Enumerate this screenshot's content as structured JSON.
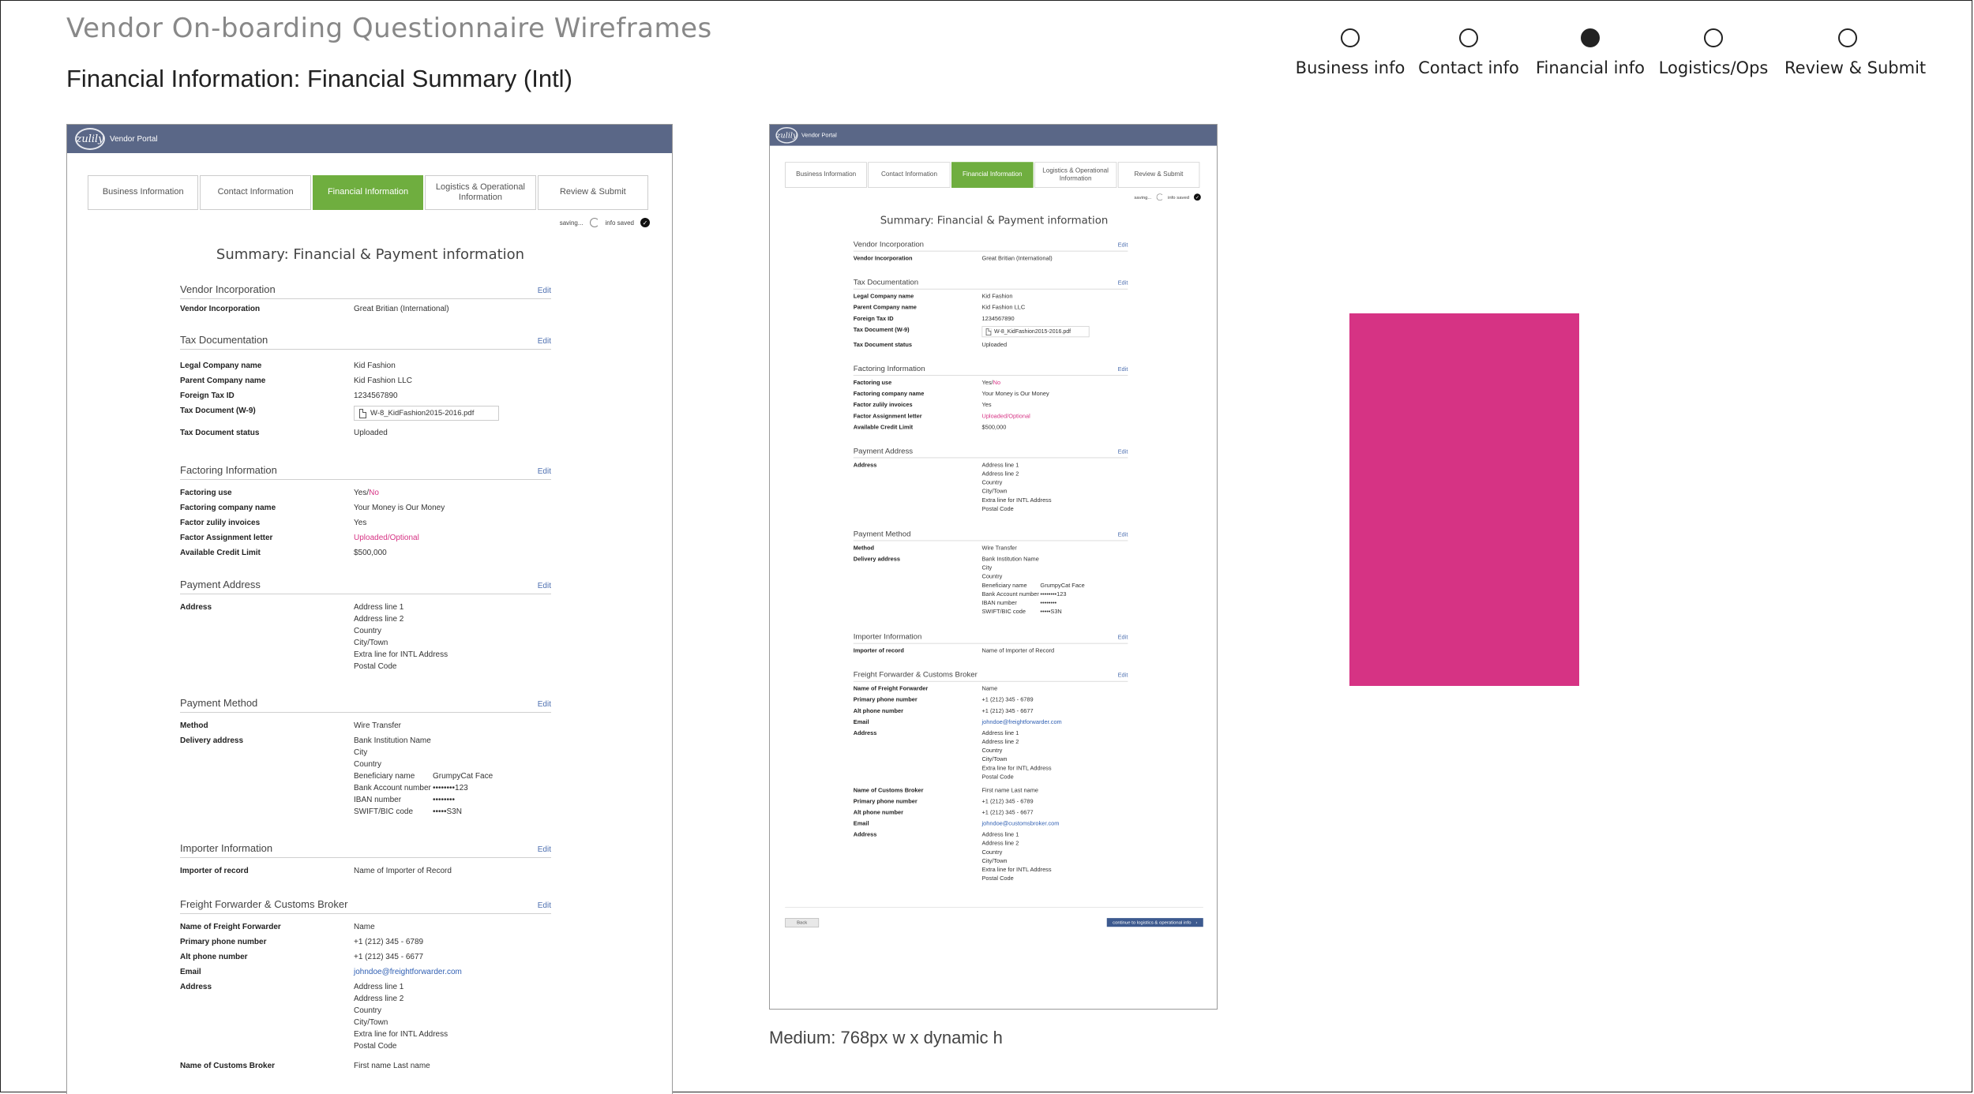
{
  "header": {
    "title": "Vendor On-boarding Questionnaire Wireframes",
    "subtitle": "Financial Information: Financial Summary (Intl)"
  },
  "stepper": {
    "steps": [
      {
        "label": "Business info",
        "active": false
      },
      {
        "label": "Contact info",
        "active": false
      },
      {
        "label": "Financial info",
        "active": true
      },
      {
        "label": "Logistics/Ops",
        "active": false
      },
      {
        "label": "Review & Submit",
        "active": false
      }
    ]
  },
  "portal": {
    "logo_text": "zulily",
    "name": "Vendor Portal",
    "tabs": [
      "Business Information",
      "Contact Information",
      "Financial Information",
      "Logistics & Operational Information",
      "Review & Submit"
    ],
    "active_tab": 2,
    "save_status": {
      "saving": "saving...",
      "saved": "info saved"
    },
    "summary_title": "Summary: Financial & Payment information",
    "edit_label": "Edit",
    "sections": {
      "vendor": {
        "title": "Vendor Incorporation",
        "rows": [
          {
            "k": "Vendor Incorporation",
            "v": "Great Britian (International)"
          }
        ]
      },
      "tax": {
        "title": "Tax Documentation",
        "rows": [
          {
            "k": "Legal Company name",
            "v": "Kid Fashion"
          },
          {
            "k": "Parent Company name",
            "v": "Kid Fashion LLC"
          },
          {
            "k": "Foreign Tax ID",
            "v": "1234567890"
          },
          {
            "k": "Tax Document (W-9)",
            "v": "W-8_KidFashion2015-2016.pdf"
          },
          {
            "k": "Tax Document status",
            "v": "Uploaded"
          }
        ]
      },
      "factoring": {
        "title": "Factoring Information",
        "use_label": "Factoring use",
        "use_yes": "Yes/",
        "use_no": "No",
        "rows": [
          {
            "k": "Factoring company name",
            "v": "Your Money is Our Money"
          },
          {
            "k": "Factor zulily invoices",
            "v": "Yes"
          }
        ],
        "assignment_label": "Factor Assignment letter",
        "assignment_value": "Uploaded/Optional",
        "credit_label": "Available Credit Limit",
        "credit_value": "$500,000"
      },
      "payment_address": {
        "title": "Payment Address",
        "label": "Address",
        "lines": [
          "Address line 1",
          "Address line 2",
          "Country",
          "City/Town",
          "Extra line for INTL Address",
          "Postal Code"
        ]
      },
      "payment_method": {
        "title": "Payment Method",
        "method_label": "Method",
        "method_value": "Wire Transfer",
        "delivery_label": "Delivery address",
        "lines": [
          "Bank Institution Name",
          "City",
          "Country"
        ],
        "pairs": [
          {
            "k": "Beneficiary name",
            "v": "GrumpyCat Face"
          },
          {
            "k": "Bank Account number",
            "v": "••••••••123"
          },
          {
            "k": "IBAN number",
            "v": "••••••••"
          },
          {
            "k": "SWIFT/BIC code",
            "v": "•••••S3N"
          }
        ]
      },
      "importer": {
        "title": "Importer Information",
        "rows": [
          {
            "k": "Importer of record",
            "v": "Name of Importer of Record"
          }
        ]
      },
      "freight": {
        "title": "Freight Forwarder & Customs Broker",
        "ff_name_label": "Name of Freight Forwarder",
        "ff_name_value": "Name",
        "primary_label": "Primary phone number",
        "primary_value": "+1 (212) 345 - 6789",
        "alt_label": "Alt phone number",
        "alt_value": "+1 (212) 345 - 6677",
        "email_label": "Email",
        "ff_email": "johndoe@freightforwarder.com",
        "address_label": "Address",
        "address_lines": [
          "Address line 1",
          "Address line 2",
          "Country",
          "City/Town",
          "Extra line for INTL Address",
          "Postal Code"
        ],
        "cb_name_label": "Name of Customs Broker",
        "cb_name_value": "First name  Last name",
        "cb_email": "johndoe@customsbroker.com"
      }
    },
    "footer": {
      "back_label": "Back",
      "continue_label": "continue to logistics & operational info"
    }
  },
  "caption": "Medium: 768px w x dynamic h",
  "colors": {
    "accent_green": "#6fae3f",
    "portal_bar": "#5a6787",
    "highlight_pink": "#d63384",
    "link_blue": "#2f5fb3"
  }
}
